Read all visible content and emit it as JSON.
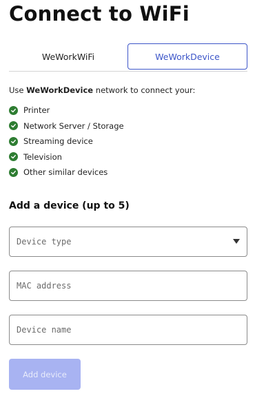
{
  "page": {
    "title": "Connect to WiFi"
  },
  "tabs": [
    {
      "label": "WeWorkWiFi",
      "active": false
    },
    {
      "label": "WeWorkDevice",
      "active": true
    }
  ],
  "intro": {
    "prefix": "Use ",
    "network": "WeWorkDevice",
    "suffix": " network to connect your:"
  },
  "devices": [
    {
      "label": "Printer",
      "icon": "check-circle-icon"
    },
    {
      "label": "Network Server / Storage",
      "icon": "check-circle-icon"
    },
    {
      "label": "Streaming device",
      "icon": "check-circle-icon"
    },
    {
      "label": "Television",
      "icon": "check-circle-icon"
    },
    {
      "label": "Other similar devices",
      "icon": "check-circle-icon"
    }
  ],
  "form": {
    "title": "Add a device (up to 5)",
    "device_type": {
      "placeholder": "Device type",
      "value": ""
    },
    "mac_address": {
      "placeholder": "MAC address",
      "value": ""
    },
    "device_name": {
      "placeholder": "Device name",
      "value": ""
    },
    "submit_label": "Add device"
  },
  "colors": {
    "accent": "#3c55c8",
    "check": "#2e7d32",
    "button_disabled": "#a8b3f2"
  }
}
